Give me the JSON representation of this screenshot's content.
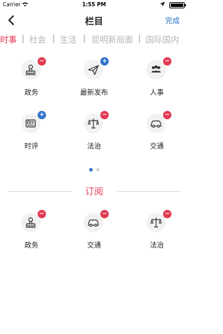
{
  "status_bar": {
    "carrier": "Carrier",
    "wifi_icon": "wifi-icon",
    "time": "1:55 PM",
    "location_icon": "location-arrow-icon",
    "battery_icon": "battery-icon"
  },
  "navbar": {
    "back_icon": "chevron-left-icon",
    "title": "栏目",
    "done_label": "完成"
  },
  "tabs": [
    {
      "label": "时事",
      "active": true
    },
    {
      "label": "社会",
      "active": false
    },
    {
      "label": "生活",
      "active": false
    },
    {
      "label": "昆明新局面",
      "active": false
    },
    {
      "label": "国际国内",
      "active": false
    }
  ],
  "columns_grid": [
    {
      "label": "政务",
      "icon": "government-stamp-icon",
      "badge": "remove"
    },
    {
      "label": "最新发布",
      "icon": "paper-plane-icon",
      "badge": "add"
    },
    {
      "label": "人事",
      "icon": "people-icon",
      "badge": "remove"
    },
    {
      "label": "时评",
      "icon": "newspaper-icon",
      "badge": "add"
    },
    {
      "label": "法治",
      "icon": "scales-icon",
      "badge": "remove"
    },
    {
      "label": "交通",
      "icon": "car-icon",
      "badge": "remove"
    }
  ],
  "pager": {
    "active_index": 0,
    "count": 2
  },
  "subscription": {
    "title": "订阅",
    "items": [
      {
        "label": "政务",
        "icon": "government-stamp-icon",
        "badge": "remove"
      },
      {
        "label": "交通",
        "icon": "car-icon",
        "badge": "remove"
      },
      {
        "label": "法治",
        "icon": "scales-icon",
        "badge": "remove"
      }
    ]
  },
  "colors": {
    "accent_red": "#e23a52",
    "accent_blue": "#2f73c9",
    "icon_bg": "#f2f2f2"
  },
  "badge_glyphs": {
    "add": "+",
    "remove": "−"
  }
}
